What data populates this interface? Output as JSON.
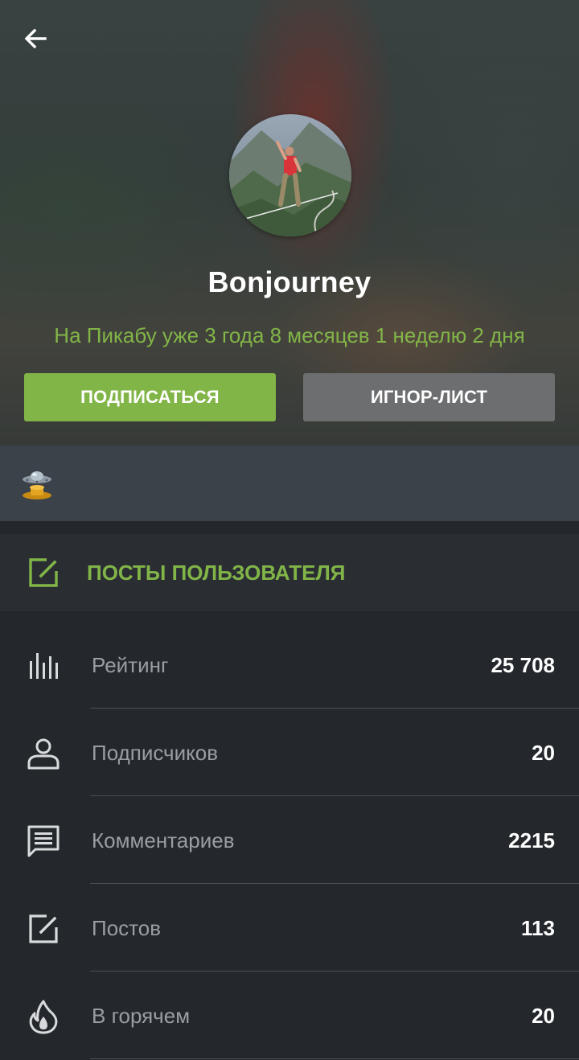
{
  "header": {
    "back_icon": "arrow-left-icon",
    "username": "Bonjourney",
    "tenure": "На Пикабу уже 3 года 8 месяцев 1 неделю 2 дня",
    "subscribe_label": "ПОДПИСАТЬСЯ",
    "ignore_label": "ИГНОР-ЛИСТ"
  },
  "awards": {
    "items": [
      {
        "icon": "ufo-award-icon"
      }
    ]
  },
  "posts_link": {
    "icon": "edit-icon",
    "label": "ПОСТЫ ПОЛЬЗОВАТЕЛЯ"
  },
  "stats": [
    {
      "icon": "rating-bars-icon",
      "label": "Рейтинг",
      "value": "25 708"
    },
    {
      "icon": "person-icon",
      "label": "Подписчиков",
      "value": "20"
    },
    {
      "icon": "comment-icon",
      "label": "Комментариев",
      "value": "2215"
    },
    {
      "icon": "edit-icon",
      "label": "Постов",
      "value": "113"
    },
    {
      "icon": "flame-icon",
      "label": "В горячем",
      "value": "20"
    }
  ],
  "colors": {
    "accent": "#82b548",
    "ignore_button": "#6d6e70",
    "background": "#24282d",
    "awards_strip": "#3c4249"
  }
}
